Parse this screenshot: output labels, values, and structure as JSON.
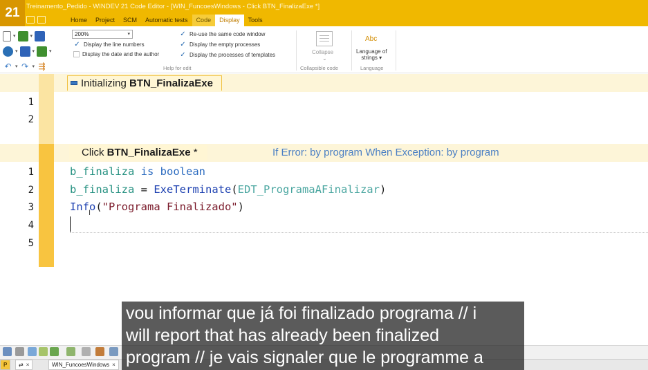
{
  "titlebar": {
    "logo": "21",
    "title": "Treinamento_Pedido - WINDEV 21  Code Editor - [WIN_FuncoesWindows - Click BTN_FinalizaExe *]"
  },
  "ribbon_tabs": [
    {
      "label": "Home"
    },
    {
      "label": "Project"
    },
    {
      "label": "SCM"
    },
    {
      "label": "Automatic tests"
    },
    {
      "label": "Code"
    },
    {
      "label": "Display"
    },
    {
      "label": "Tools"
    }
  ],
  "ribbon": {
    "zoom_value": "200%",
    "options": {
      "line_numbers": "Display the line numbers",
      "date_author": "Display the date and the author",
      "reuse_window": "Re-use the same code window",
      "empty_processes": "Display the empty processes",
      "template_processes": "Display the processes of templates"
    },
    "collapse_label": "Collapse",
    "language_label_1": "Language of",
    "language_label_2": "strings",
    "abc_icon_text": "Abc",
    "group_help": "Help for edit",
    "group_collapsible": "Collapsible code",
    "group_language": "Language"
  },
  "editor": {
    "init_prefix": "Initializing ",
    "init_name": "BTN_FinalizaExe",
    "init_lines": [
      "1",
      "2"
    ],
    "click_prefix": "Click ",
    "click_name": "BTN_FinalizaExe",
    "click_modified": " *",
    "error_info": "If Error: by program  When Exception: by program",
    "click_lines": [
      "1",
      "2",
      "3",
      "4",
      "5"
    ],
    "code": {
      "l1_var": "b_finaliza",
      "l1_kw": " is ",
      "l1_type": "boolean",
      "l2_var": "b_finaliza",
      "l2_op": " = ",
      "l2_fn": "ExeTerminate",
      "l2_open": "(",
      "l2_arg": "EDT_ProgramaAFinalizar",
      "l2_close": ")",
      "l3_fn": "Info",
      "l3_open": "(",
      "l3_str": "\"Programa Finalizado\"",
      "l3_close": ")"
    }
  },
  "doc_tab": {
    "label": "WIN_FuncoesWindows",
    "close": "×"
  },
  "subtitle": {
    "line1": "vou informar que já foi finalizado programa // i",
    "line2": "will report that has already been finalized",
    "line3": "program // je vais signaler que le programme a"
  }
}
